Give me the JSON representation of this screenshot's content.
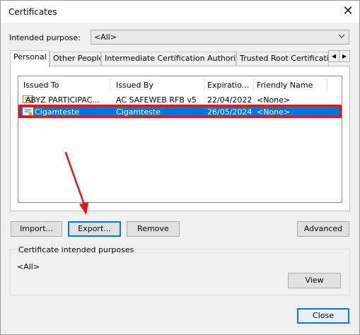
{
  "window": {
    "title": "Certificates",
    "close_glyph": "✕"
  },
  "purpose": {
    "label": "Intended purpose:",
    "value": "<All>",
    "chevron": "⌵"
  },
  "tabs": [
    {
      "label": "Personal",
      "active": true
    },
    {
      "label": "Other People",
      "active": false
    },
    {
      "label": "Intermediate Certification Authorities",
      "active": false
    },
    {
      "label": "Trusted Root Certification Authorities",
      "active": false
    }
  ],
  "tab_scroll": {
    "left": "◀",
    "right": "▶"
  },
  "list": {
    "columns": [
      "Issued To",
      "Issued By",
      "Expiratio...",
      "Friendly Name"
    ],
    "rows": [
      {
        "issued_to": "ABYZ PARTICIPAC...",
        "issued_by": "AC SAFEWEB RFB v5",
        "expiration": "22/04/2022",
        "friendly_name": "<None>",
        "selected": false
      },
      {
        "issued_to": "Cigamteste",
        "issued_by": "Cigamteste",
        "expiration": "26/05/2024",
        "friendly_name": "<None>",
        "selected": true
      }
    ]
  },
  "buttons": {
    "import": "Import...",
    "export": "Export...",
    "remove": "Remove",
    "advanced": "Advanced",
    "view": "View",
    "close": "Close"
  },
  "purposes_group": {
    "label": "Certificate intended purposes",
    "value": "<All>"
  },
  "annotation": {
    "highlight_color": "#e8121b",
    "arrow_color": "#e8121b"
  },
  "colors": {
    "selection": "#0078d7"
  }
}
